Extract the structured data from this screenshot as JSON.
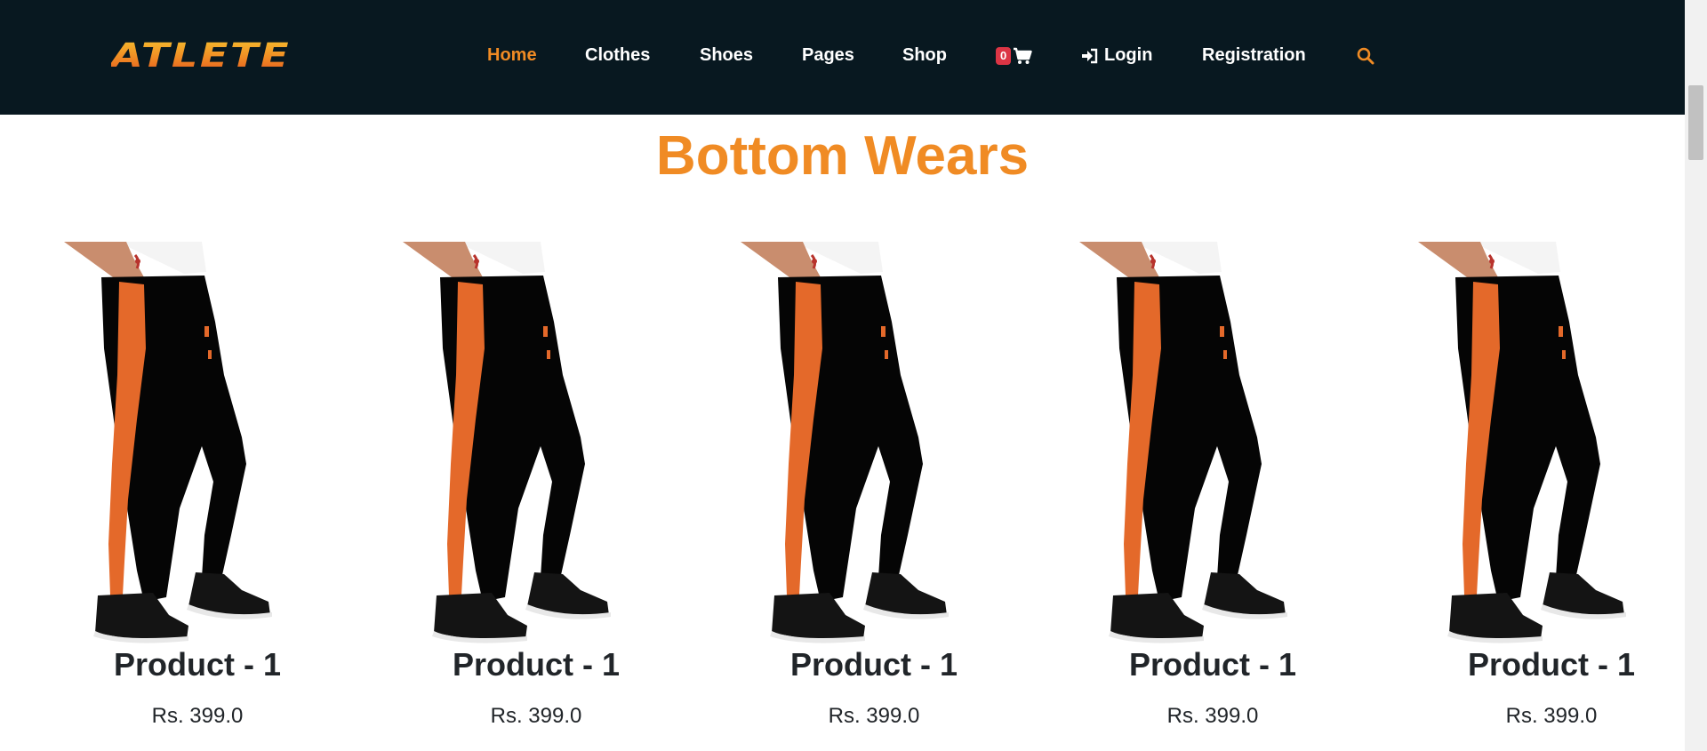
{
  "brand": {
    "logo_text": "ATLETE"
  },
  "nav": {
    "home": "Home",
    "clothes": "Clothes",
    "shoes": "Shoes",
    "pages": "Pages",
    "shop": "Shop",
    "cart_count": "0",
    "login": "Login",
    "registration": "Registration"
  },
  "section": {
    "title": "Bottom Wears"
  },
  "products": [
    {
      "name": "Product - 1",
      "price": "Rs. 399.0"
    },
    {
      "name": "Product - 1",
      "price": "Rs. 399.0"
    },
    {
      "name": "Product - 1",
      "price": "Rs. 399.0"
    },
    {
      "name": "Product - 1",
      "price": "Rs. 399.0"
    },
    {
      "name": "Product - 1",
      "price": "Rs. 399.0"
    }
  ],
  "colors": {
    "navbar_bg": "#081820",
    "accent": "#f08b24",
    "badge": "#dc3545",
    "text": "#212529"
  },
  "icons": {
    "cart": "shopping-cart-icon",
    "login": "sign-in-icon",
    "search": "search-icon"
  }
}
